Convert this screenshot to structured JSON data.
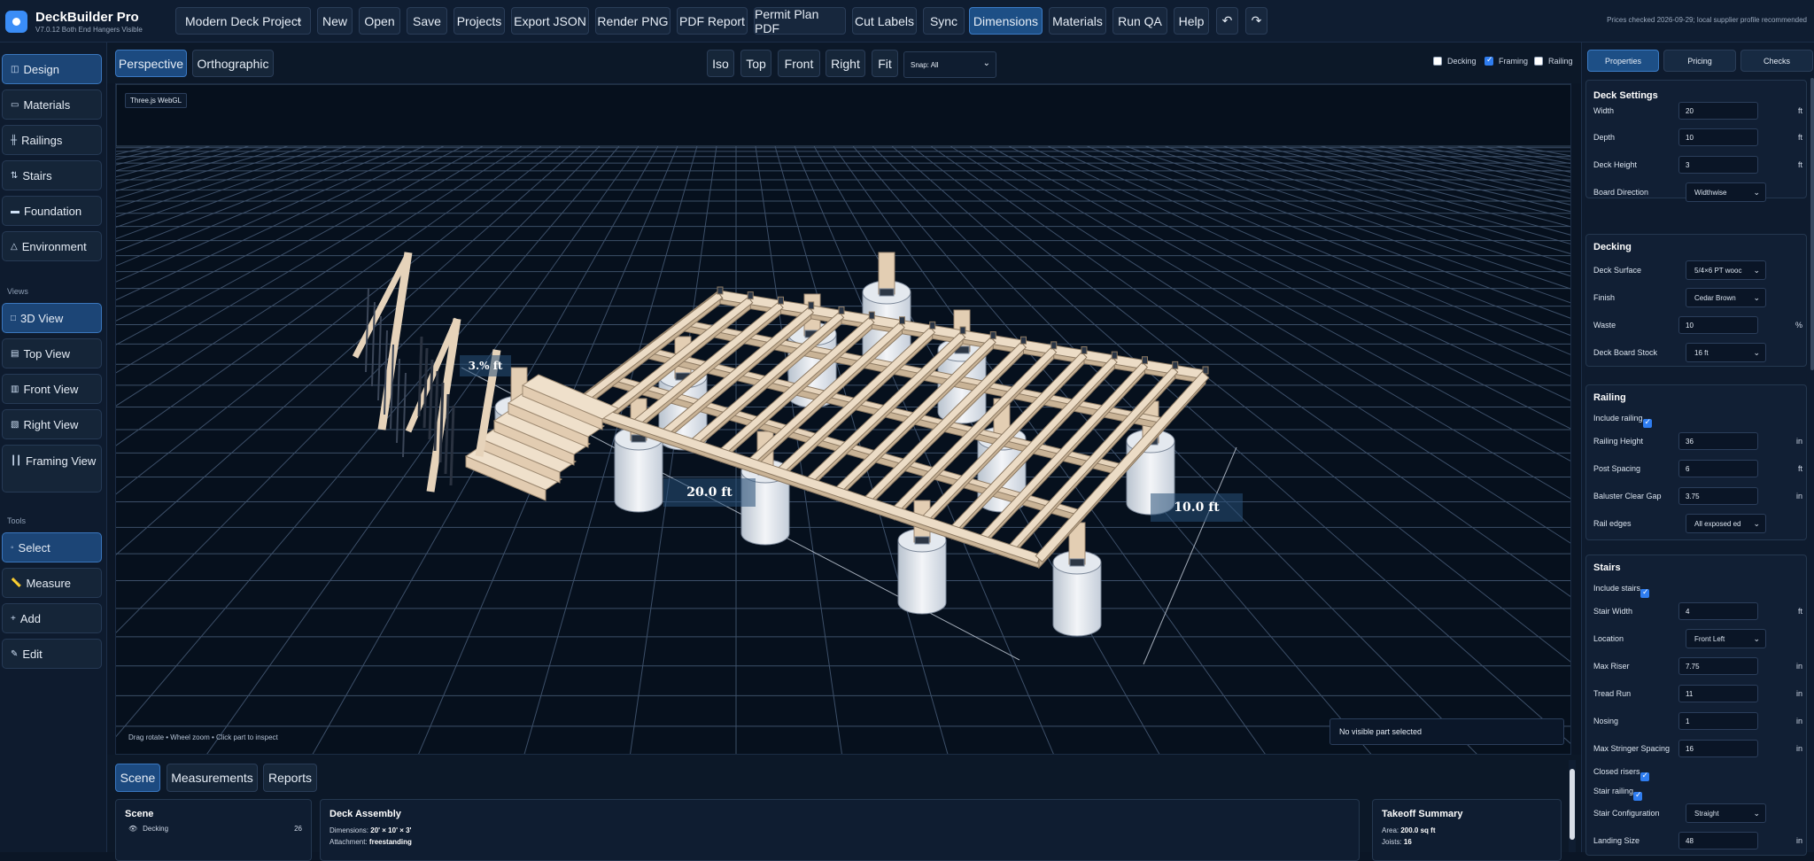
{
  "app": {
    "title": "DeckBuilder Pro",
    "subtitle": "V7.0.12 Both End Hangers Visible",
    "prices_note": "Prices checked 2026-09-29; local supplier profile recommended"
  },
  "toolbar": {
    "project": "Modern Deck Project",
    "buttons": [
      "New",
      "Open",
      "Save",
      "Projects",
      "Export JSON",
      "Render PNG",
      "PDF Report",
      "Permit Plan PDF",
      "Cut Labels",
      "Sync",
      "Dimensions",
      "Materials",
      "Run QA",
      "Help"
    ],
    "undo": "↶",
    "redo": "↷"
  },
  "leftnav": {
    "items": [
      {
        "label": "Design",
        "icon": "◫"
      },
      {
        "label": "Materials",
        "icon": "▭"
      },
      {
        "label": "Railings",
        "icon": "╫"
      },
      {
        "label": "Stairs",
        "icon": "⇅"
      },
      {
        "label": "Foundation",
        "icon": "▬"
      },
      {
        "label": "Environment",
        "icon": "△"
      }
    ],
    "views_heading": "Views",
    "views": [
      {
        "label": "3D View",
        "icon": "□"
      },
      {
        "label": "Top View",
        "icon": "▤"
      },
      {
        "label": "Front View",
        "icon": "▥"
      },
      {
        "label": "Right View",
        "icon": "▧"
      },
      {
        "label": "Framing View",
        "icon": "┃┃"
      }
    ],
    "tools_heading": "Tools",
    "tools": [
      {
        "label": "Select",
        "icon": "◦"
      },
      {
        "label": "Measure",
        "icon": "📏"
      },
      {
        "label": "Add",
        "icon": "+"
      },
      {
        "label": "Edit",
        "icon": "✎"
      }
    ]
  },
  "viewport": {
    "projection": [
      "Perspective",
      "Orthographic"
    ],
    "views": [
      "Iso",
      "Top",
      "Front",
      "Right",
      "Fit"
    ],
    "snap": "Snap: All",
    "toggles": [
      {
        "label": "Decking",
        "checked": false
      },
      {
        "label": "Framing",
        "checked": true
      },
      {
        "label": "Railing",
        "checked": false
      }
    ],
    "renderer_tag": "Three.js WebGL",
    "hint": "Drag rotate • Wheel zoom • Click part to inspect",
    "selection": "No visible part selected",
    "labels": {
      "width": "20.0 ft",
      "depth": "10.0 ft",
      "height": "3.% ft"
    }
  },
  "bottom": {
    "tabs": [
      "Scene",
      "Measurements",
      "Reports"
    ],
    "scene": {
      "title": "Scene",
      "row_label": "Decking",
      "row_count": "26"
    },
    "assembly": {
      "title": "Deck Assembly",
      "dimensions_label": "Dimensions:",
      "dimensions": "20' × 10' × 3'",
      "attachment_label": "Attachment:",
      "attachment": "freestanding"
    },
    "takeoff": {
      "title": "Takeoff Summary",
      "area_label": "Area:",
      "area": "200.0 sq ft",
      "joists_label": "Joists:",
      "joists": "16"
    }
  },
  "rightpanel": {
    "tabs": [
      "Properties",
      "Pricing",
      "Checks"
    ],
    "deck_settings": {
      "title": "Deck Settings",
      "width_label": "Width",
      "width": "20",
      "width_unit": "ft",
      "depth_label": "Depth",
      "depth": "10",
      "depth_unit": "ft",
      "height_label": "Deck Height",
      "height": "3",
      "height_unit": "ft",
      "board_dir_label": "Board Direction",
      "board_dir": "Widthwise"
    },
    "decking": {
      "title": "Decking",
      "surface_label": "Deck Surface",
      "surface": "5/4×6 PT wooc",
      "finish_label": "Finish",
      "finish": "Cedar Brown",
      "waste_label": "Waste",
      "waste": "10",
      "waste_unit": "%",
      "stock_label": "Deck Board Stock",
      "stock": "16 ft"
    },
    "railing": {
      "title": "Railing",
      "include_label": "Include railing",
      "height_label": "Railing Height",
      "height": "36",
      "height_unit": "in",
      "post_label": "Post Spacing",
      "post": "6",
      "post_unit": "ft",
      "gap_label": "Baluster Clear Gap",
      "gap": "3.75",
      "gap_unit": "in",
      "edges_label": "Rail edges",
      "edges": "All exposed ed"
    },
    "stairs": {
      "title": "Stairs",
      "include_label": "Include stairs",
      "width_label": "Stair Width",
      "width": "4",
      "width_unit": "ft",
      "location_label": "Location",
      "location": "Front Left",
      "riser_label": "Max Riser",
      "riser": "7.75",
      "riser_unit": "in",
      "tread_label": "Tread Run",
      "tread": "11",
      "tread_unit": "in",
      "nosing_label": "Nosing",
      "nosing": "1",
      "nosing_unit": "in",
      "stringer_label": "Max Stringer Spacing",
      "stringer": "16",
      "stringer_unit": "in",
      "closed_label": "Closed risers",
      "stair_rail_label": "Stair railing",
      "config_label": "Stair Configuration",
      "config": "Straight",
      "landing_label": "Landing Size",
      "landing": "48",
      "landing_unit": "in"
    }
  },
  "colors": {
    "accent": "#1d4f86",
    "lumber": "#e8d5bd",
    "grid": "#5b6f8a",
    "background": "#06101d"
  }
}
